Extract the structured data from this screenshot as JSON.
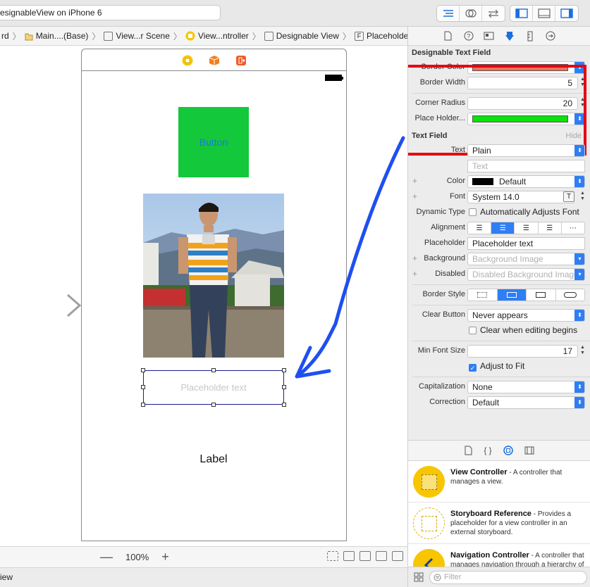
{
  "toolbar": {
    "scheme": "esignableView on iPhone 6"
  },
  "jumpbar": {
    "crumbs": [
      "rd",
      "Main....(Base)",
      "View...r Scene",
      "View...ntroller",
      "Designable View",
      "Placeholder text"
    ]
  },
  "canvas": {
    "button_label": "Button",
    "textfield_placeholder": "Placeholder text",
    "label_text": "Label"
  },
  "bottom_bar": {
    "zoom": "100%",
    "minus": "—",
    "plus": "+",
    "status": "iew"
  },
  "inspector": {
    "designable": {
      "title": "Designable Text Field",
      "border_color_label": "Border Color",
      "border_color": "#f0705a",
      "border_width_label": "Border Width",
      "border_width": "5",
      "corner_radius_label": "Corner Radius",
      "corner_radius": "20",
      "placeholder_label": "Place Holder...",
      "placeholder_color": "#0ae20a"
    },
    "text_field": {
      "title": "Text Field",
      "hide": "Hide",
      "text_label": "Text",
      "text_value": "Plain",
      "text_placeholder": "Text",
      "color_label": "Color",
      "color_value": "Default",
      "font_label": "Font",
      "font_value": "System 14.0",
      "dynamic_label": "Dynamic Type",
      "dynamic_value": "Automatically Adjusts Font",
      "alignment_label": "Alignment",
      "placeholder_label": "Placeholder",
      "placeholder_value": "Placeholder text",
      "background_label": "Background",
      "background_value": "Background Image",
      "disabled_label": "Disabled",
      "disabled_value": "Disabled Background Image",
      "border_style_label": "Border Style",
      "clear_button_label": "Clear Button",
      "clear_button_value": "Never appears",
      "clear_editing": "Clear when editing begins",
      "min_font_label": "Min Font Size",
      "min_font_value": "17",
      "adjust_fit": "Adjust to Fit",
      "capitalization_label": "Capitalization",
      "capitalization_value": "None",
      "correction_label": "Correction",
      "correction_value": "Default"
    }
  },
  "library": {
    "items": [
      {
        "title": "View Controller",
        "desc": " - A controller that manages a view."
      },
      {
        "title": "Storyboard Reference",
        "desc": " - Provides a placeholder for a view controller in an external storyboard."
      },
      {
        "title": "Navigation Controller",
        "desc": " - A controller that manages navigation through a hierarchy of views."
      }
    ],
    "filter_placeholder": "Filter"
  },
  "colors": {
    "accent": "#2f7ef3",
    "highlight": "#e60012",
    "annotation_arrow": "#1f4ff0"
  }
}
